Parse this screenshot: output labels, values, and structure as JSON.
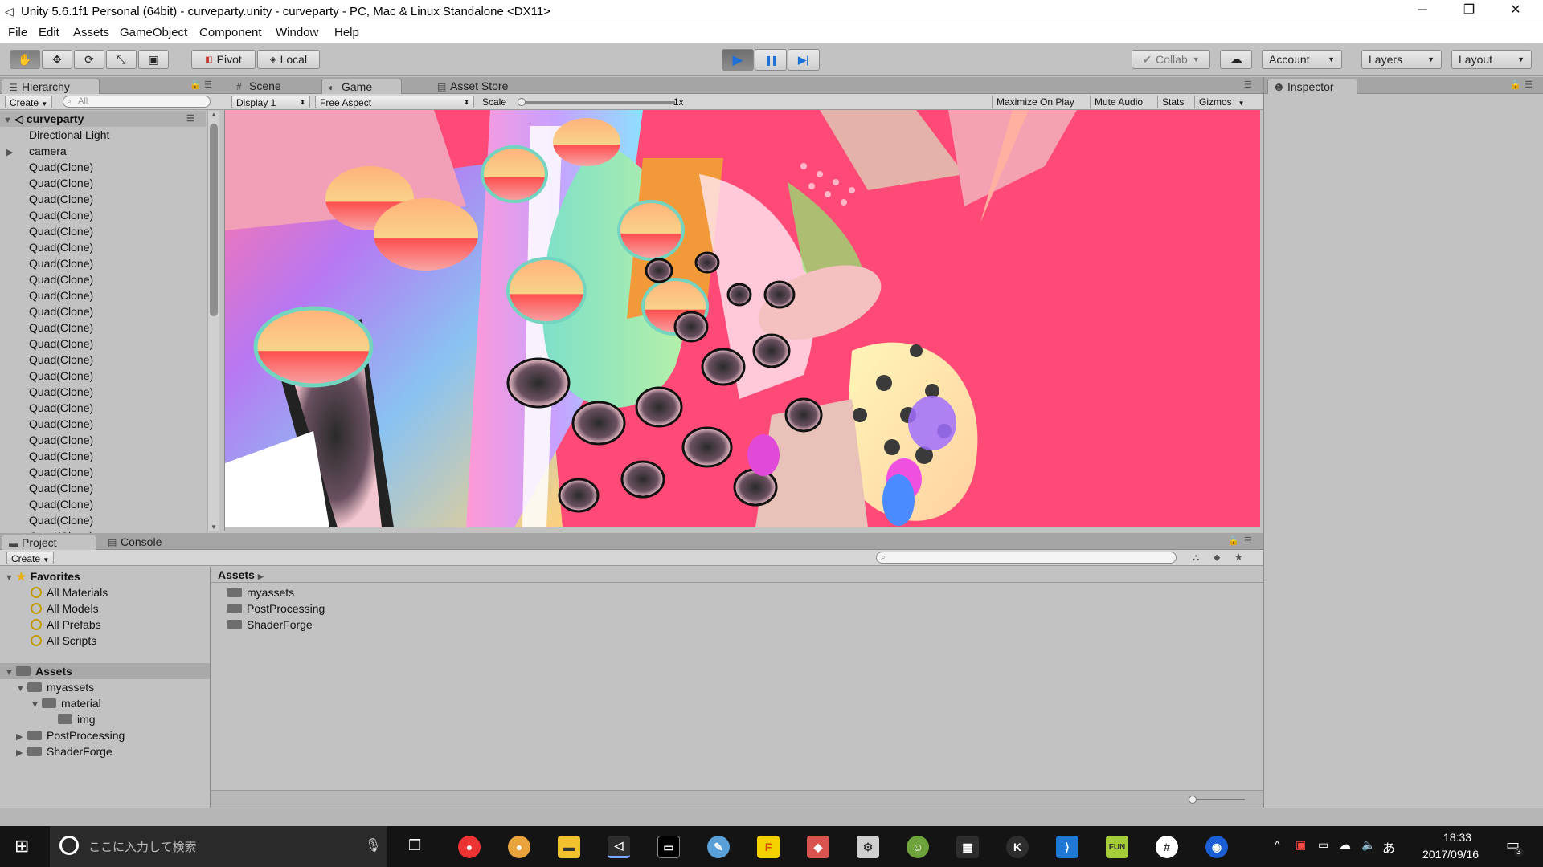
{
  "window": {
    "title": "Unity 5.6.1f1 Personal (64bit) - curveparty.unity - curveparty - PC, Mac & Linux Standalone <DX11>",
    "min_glyph": "─",
    "max_glyph": "❐",
    "close_glyph": "✕"
  },
  "menu": [
    "File",
    "Edit",
    "Assets",
    "GameObject",
    "Component",
    "Window",
    "Help"
  ],
  "toolbar": {
    "tools": [
      "hand-icon",
      "move-icon",
      "rotate-icon",
      "scale-icon",
      "rect-icon"
    ],
    "tool_glyphs": [
      "✋",
      "✥",
      "⟳",
      "⤡",
      "▣"
    ],
    "pivot": "Pivot",
    "local": "Local",
    "play_glyph": "▶",
    "pause_glyph": "❚❚",
    "step_glyph": "▶|",
    "collab": "Collab",
    "cloud_glyph": "☁",
    "account": "Account",
    "layers": "Layers",
    "layout": "Layout"
  },
  "hierarchy": {
    "tab": "Hierarchy",
    "create": "Create",
    "search_placeholder": "All",
    "scene": "curveparty",
    "items": [
      "Directional Light",
      "camera",
      "Quad(Clone)",
      "Quad(Clone)",
      "Quad(Clone)",
      "Quad(Clone)",
      "Quad(Clone)",
      "Quad(Clone)",
      "Quad(Clone)",
      "Quad(Clone)",
      "Quad(Clone)",
      "Quad(Clone)",
      "Quad(Clone)",
      "Quad(Clone)",
      "Quad(Clone)",
      "Quad(Clone)",
      "Quad(Clone)",
      "Quad(Clone)",
      "Quad(Clone)",
      "Quad(Clone)",
      "Quad(Clone)",
      "Quad(Clone)",
      "Quad(Clone)",
      "Quad(Clone)",
      "Quad(Clone)",
      "Quad(Clone)"
    ]
  },
  "view_tabs": {
    "scene": "Scene",
    "game": "Game",
    "store": "Asset Store"
  },
  "game_bar": {
    "display": "Display 1",
    "aspect": "Free Aspect",
    "scale_label": "Scale",
    "scale_value": "1x",
    "maximize": "Maximize On Play",
    "mute": "Mute Audio",
    "stats": "Stats",
    "gizmos": "Gizmos"
  },
  "inspector": {
    "tab": "Inspector"
  },
  "project": {
    "tab": "Project",
    "console": "Console",
    "create": "Create",
    "favorites_label": "Favorites",
    "favorites": [
      "All Materials",
      "All Models",
      "All Prefabs",
      "All Scripts"
    ],
    "assets_label": "Assets",
    "tree": [
      "myassets",
      "material",
      "img",
      "PostProcessing",
      "ShaderForge"
    ],
    "breadcrumb": "Assets",
    "contents": [
      "myassets",
      "PostProcessing",
      "ShaderForge"
    ]
  },
  "taskbar": {
    "search_placeholder": "ここに入力して検索",
    "time": "18:33",
    "date": "2017/09/16",
    "ime": "あ",
    "notifications": "3"
  },
  "colors": {
    "game_bg": "#ff4a78",
    "play_accent": "#1f6fd8"
  }
}
